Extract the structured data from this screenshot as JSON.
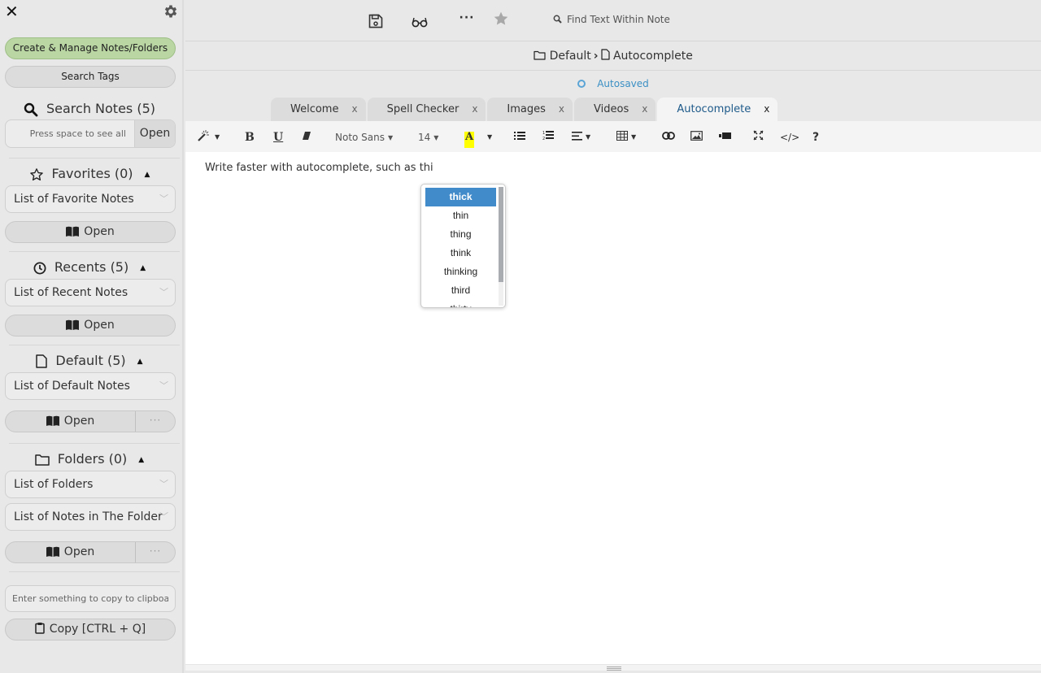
{
  "sidebar": {
    "close_icon": "close-icon",
    "settings_icon": "gear-icon",
    "create_manage_label": "Create & Manage Notes/Folders",
    "search_tags_label": "Search Tags",
    "search_notes": {
      "title": "Search Notes (5)",
      "placeholder": "Press space to see all",
      "value": "",
      "open_label": "Open"
    },
    "favorites": {
      "title": "Favorites (0)",
      "select_value": "List of Favorite Notes",
      "open_label": "Open"
    },
    "recents": {
      "title": "Recents (5)",
      "select_value": "List of Recent Notes",
      "open_label": "Open"
    },
    "default": {
      "title": "Default (5)",
      "select_value": "List of Default Notes",
      "open_label": "Open",
      "more_label": "···"
    },
    "folders": {
      "title": "Folders (0)",
      "select_value": "List of Folders",
      "notes_select_value": "List of Notes in The Folder",
      "open_label": "Open",
      "more_label": "···"
    },
    "clipboard": {
      "placeholder": "Enter something to copy to clipboard",
      "value": "",
      "copy_label": "Copy [CTRL + Q]"
    },
    "collapse_caret": "▲"
  },
  "topbar": {
    "more_label": "···",
    "find_placeholder": "Find Text Within Note",
    "find_value": ""
  },
  "breadcrumb": {
    "folder": "Default",
    "separator": "›",
    "note": "Autocomplete"
  },
  "status": {
    "text": "Autosaved"
  },
  "tabs": [
    {
      "label": "Welcome",
      "close": "x",
      "active": false
    },
    {
      "label": "Spell Checker",
      "close": "x",
      "active": false
    },
    {
      "label": "Images",
      "close": "x",
      "active": false
    },
    {
      "label": "Videos",
      "close": "x",
      "active": false
    },
    {
      "label": "Autocomplete",
      "close": "x",
      "active": true
    }
  ],
  "toolbar": {
    "bold": "B",
    "underline": "U",
    "font_name": "Noto Sans",
    "font_size": "14",
    "highlight": "A",
    "highlight_color": "#ffff00",
    "code_view": "</>",
    "help": "?"
  },
  "editor": {
    "content": "Write faster with autocomplete, such as thi"
  },
  "autocomplete": {
    "items": [
      "thick",
      "thin",
      "thing",
      "think",
      "thinking",
      "third",
      "thirty"
    ],
    "selected_index": 0,
    "scroll_fraction": 0.0
  },
  "colors": {
    "accent_blue": "#428bca",
    "create_button_green": "#b9d6a3",
    "active_tab_text": "#1e5a8a",
    "status_blue": "#3b8fc4"
  }
}
